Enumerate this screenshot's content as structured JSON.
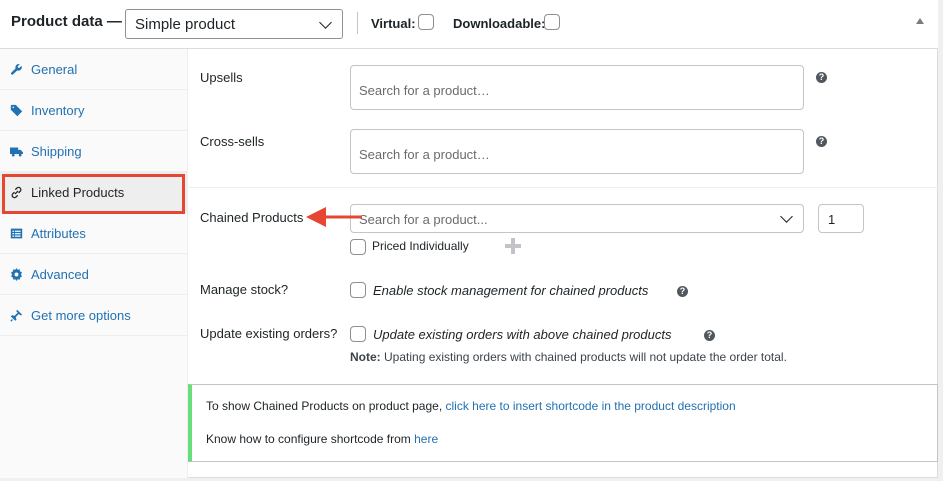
{
  "header": {
    "title": "Product data —",
    "product_type": "Simple product",
    "virtual_label": "Virtual:",
    "downloadable_label": "Downloadable:"
  },
  "sidebar": {
    "items": [
      {
        "label": "General",
        "icon": "wrench-icon"
      },
      {
        "label": "Inventory",
        "icon": "tag-icon"
      },
      {
        "label": "Shipping",
        "icon": "truck-icon"
      },
      {
        "label": "Linked Products",
        "icon": "link-icon",
        "active": true
      },
      {
        "label": "Attributes",
        "icon": "list-icon"
      },
      {
        "label": "Advanced",
        "icon": "gear-icon"
      },
      {
        "label": "Get more options",
        "icon": "plugin-icon"
      }
    ]
  },
  "linked": {
    "upsells_label": "Upsells",
    "upsells_placeholder": "Search for a product…",
    "crosssells_label": "Cross-sells",
    "crosssells_placeholder": "Search for a product…"
  },
  "chained": {
    "label": "Chained Products",
    "placeholder": "Search for a product...",
    "quantity": "1",
    "priced_individually": "Priced Individually",
    "manage_stock_label": "Manage stock?",
    "manage_stock_text": "Enable stock management for chained products",
    "update_orders_label": "Update existing orders?",
    "update_orders_text": "Update existing orders with above chained products",
    "note_bold": "Note:",
    "note_text": "Upating existing orders with chained products will not update the order total."
  },
  "notice": {
    "line1_text": "To show Chained Products on product page,",
    "line1_link": "click here to insert shortcode in the product description",
    "line2_text": "Know how to configure shortcode from",
    "line2_link": "here"
  },
  "colors": {
    "link": "#2271b1",
    "highlight": "#e54733",
    "notice_border": "#68de7c"
  }
}
